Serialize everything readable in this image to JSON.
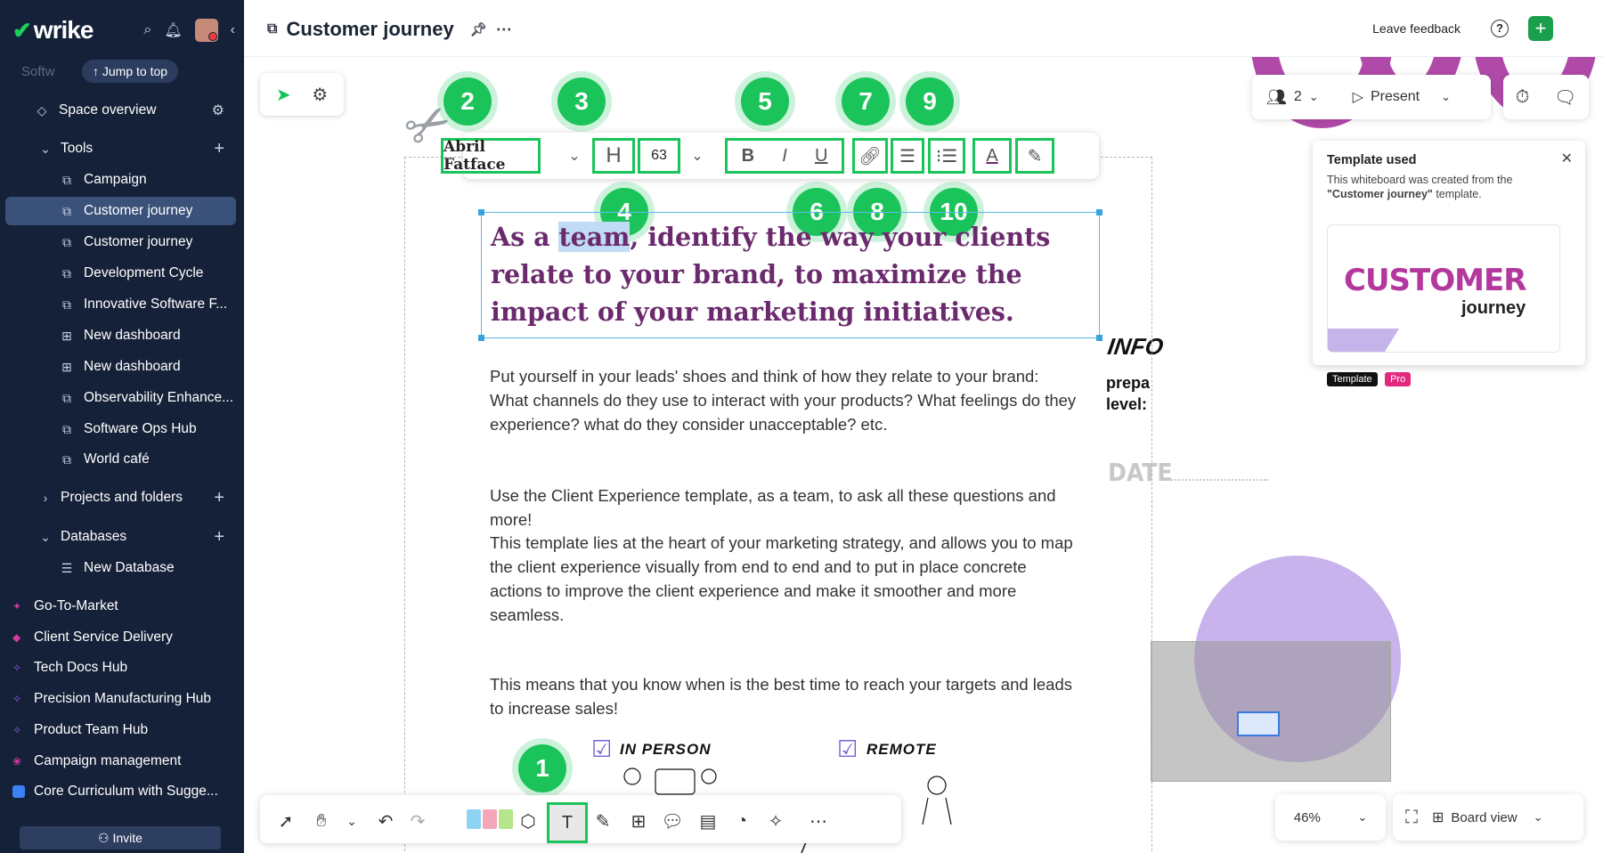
{
  "sidebar": {
    "logo": "wrike",
    "jump_ghost": "Softw",
    "jump_label": "↑ Jump to top",
    "space_overview": "Space overview",
    "tools": "Tools",
    "tool_items": [
      "Campaign",
      "Customer journey",
      "Customer journey",
      "Development Cycle",
      "Innovative Software F...",
      "New dashboard",
      "New dashboard",
      "Observability Enhance...",
      "Software Ops Hub",
      "World café"
    ],
    "projects": "Projects and folders",
    "databases": "Databases",
    "new_database": "New Database",
    "spaces": [
      "Go-To-Market",
      "Client Service Delivery",
      "Tech Docs Hub",
      "Precision Manufacturing Hub",
      "Product Team Hub",
      "Campaign management",
      "Core Curriculum with Sugge..."
    ],
    "space_colors": [
      "#d23aa0",
      "#d23aa0",
      "#8a5cf0",
      "#8a5cf0",
      "#8a5cf0",
      "#d23aa0",
      "#3b82f6"
    ],
    "invite": "Invite"
  },
  "topbar": {
    "title": "Customer journey",
    "leave_feedback": "Leave feedback",
    "help": "?",
    "plus": "+"
  },
  "collab": {
    "people_count": "2",
    "present": "Present"
  },
  "format_toolbar": {
    "font": "Abril Fatface",
    "heading": "H",
    "size": "63",
    "bold": "B",
    "italic": "I",
    "underline": "U",
    "text_color": "A"
  },
  "callouts": [
    "1",
    "2",
    "3",
    "4",
    "5",
    "6",
    "7",
    "8",
    "9",
    "10"
  ],
  "heading": {
    "part1": "As a ",
    "selected": "team",
    "part2": ", identify the way your clients relate to your brand, to maximize the impact of your marketing initiatives."
  },
  "body": {
    "p1": "Put yourself in your leads' shoes and think of how they relate to your brand: What channels do they use to interact with your products? What feelings do they experience? what do they consider unacceptable? etc.",
    "p2": "Use the Client Experience template, as a team, to ask all these questions and more!",
    "p3": "This template lies at the heart of your marketing strategy, and allows you to map the client experience visually from end to end and to put in place concrete actions to improve the client experience and make it smoother and more seamless.",
    "p4": "This means that you know when is the best time to reach your targets and leads to increase sales!"
  },
  "sketch": {
    "in_person": "IN PERSON",
    "remote": "REMOTE"
  },
  "template_card": {
    "title": "Template used",
    "desc_prefix": "This whiteboard was created from the",
    "desc_name": "\"Customer journey\"",
    "desc_suffix": "template.",
    "thumb_title": "CUSTOMER",
    "thumb_sub": "journey",
    "badge_template": "Template",
    "badge_pro": "Pro"
  },
  "right_canvas": {
    "info": "INFO",
    "prep": "prepa",
    "level": "level:",
    "date": "DATE"
  },
  "zoom": "46%",
  "view": "Board view"
}
